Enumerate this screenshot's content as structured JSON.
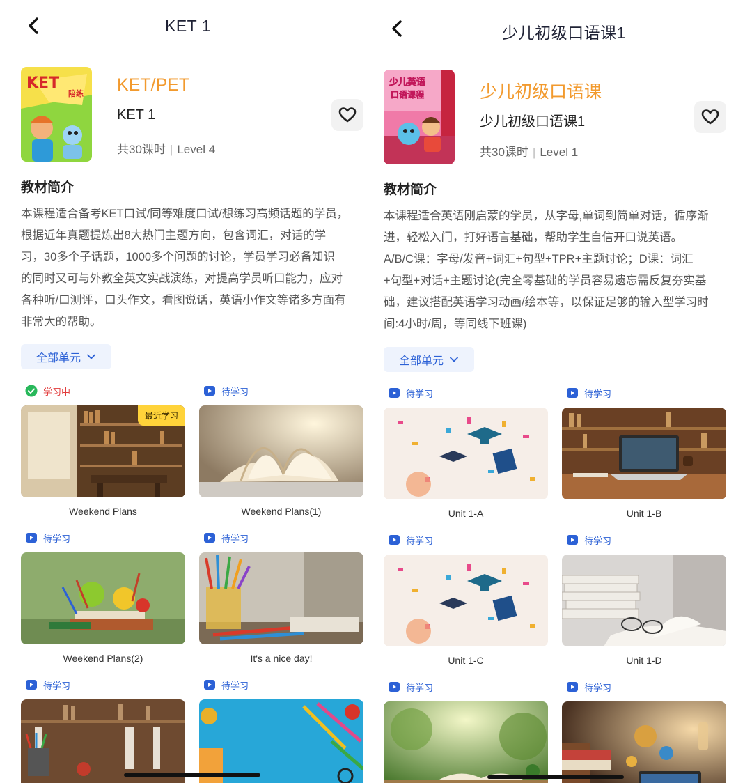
{
  "left": {
    "nav_title": "KET 1",
    "series": "KET/PET",
    "book": "KET 1",
    "lessons": "共30课时",
    "level": "Level 4",
    "cover_text": "KET",
    "cover_tag": "陪练",
    "section_title": "教材简介",
    "description_lines": [
      "本课程适合备考KET口试/同等难度口试/想练习高频话题的学员，",
      "根据近年真题提炼出8大热门主题方向，包含词汇，对话的学",
      "习，30多个子话题，1000多个问题的讨论，学员学习必备知识",
      "的同时又可与外教全英文实战演练，对提高学员听口能力，应对",
      "各种听/口测评，口头作文，看图说话，英语小作文等诸多方面有",
      "非常大的帮助。"
    ],
    "filter_label": "全部单元",
    "units": [
      {
        "status": "学习中",
        "status_type": "learning",
        "badge": "最近学习",
        "title": "Weekend Plans",
        "scene": "library-room"
      },
      {
        "status": "待学习",
        "status_type": "pending",
        "title": "Weekend Plans(1)",
        "scene": "open-book"
      },
      {
        "status": "待学习",
        "status_type": "pending",
        "title": "Weekend Plans(2)",
        "scene": "apples-books"
      },
      {
        "status": "待学习",
        "status_type": "pending",
        "title": "It's a nice day!",
        "scene": "pencils"
      },
      {
        "status": "待学习",
        "status_type": "pending",
        "title": "",
        "scene": "bookshelf-dark"
      },
      {
        "status": "待学习",
        "status_type": "pending",
        "title": "",
        "scene": "blue-desk"
      }
    ]
  },
  "right": {
    "nav_title": "少儿初级口语课1",
    "series": "少儿初级口语课",
    "book": "少儿初级口语课1",
    "lessons": "共30课时",
    "level": "Level 1",
    "cover_text": "少儿英语",
    "cover_sub": "口语课程",
    "section_title": "教材简介",
    "description_lines": [
      "本课程适合英语刚启蒙的学员，从字母,单词到简单对话，循序渐",
      "进，轻松入门，打好语言基础，帮助学生自信开口说英语。",
      "A/B/C课：字母/发音+词汇+句型+TPR+主题讨论；D课：词汇",
      "+句型+对话+主题讨论(完全零基础的学员容易遗忘需反复夯实基",
      "础，建议搭配英语学习动画/绘本等，以保证足够的输入型学习时",
      "间:4小时/周，等同线下班课)"
    ],
    "filter_label": "全部单元",
    "units": [
      {
        "status": "待学习",
        "status_type": "pending",
        "title": "Unit 1-A",
        "scene": "confetti"
      },
      {
        "status": "待学习",
        "status_type": "pending",
        "title": "Unit 1-B",
        "scene": "laptop-library"
      },
      {
        "status": "待学习",
        "status_type": "pending",
        "title": "Unit 1-C",
        "scene": "confetti"
      },
      {
        "status": "待学习",
        "status_type": "pending",
        "title": "Unit 1-D",
        "scene": "book-glasses"
      },
      {
        "status": "待学习",
        "status_type": "pending",
        "title": "",
        "scene": "garden-book"
      },
      {
        "status": "待学习",
        "status_type": "pending",
        "title": "",
        "scene": "science-desk"
      }
    ]
  },
  "colors": {
    "series": "#f29a2e",
    "accent": "#2c61d6",
    "learning": "#e23b3b",
    "badge": "#ffd33a"
  }
}
